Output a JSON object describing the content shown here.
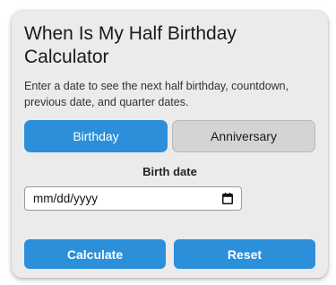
{
  "calculator": {
    "title": "When Is My Half Birthday Calculator",
    "description": "Enter a date to see the next half birthday, countdown, previous date, and quarter dates."
  },
  "tabs": [
    {
      "label": "Birthday",
      "active": true
    },
    {
      "label": "Anniversary",
      "active": false
    }
  ],
  "form": {
    "birth_date_label": "Birth date",
    "birth_date_value": "",
    "birth_date_placeholder": "mm/dd/yyyy"
  },
  "actions": {
    "calculate_label": "Calculate",
    "reset_label": "Reset"
  },
  "icons": {
    "date_picker": "calendar-icon"
  },
  "colors": {
    "accent": "#2b8fd9",
    "card_background": "#ebebeb",
    "inactive_tab": "#d4d4d4"
  }
}
